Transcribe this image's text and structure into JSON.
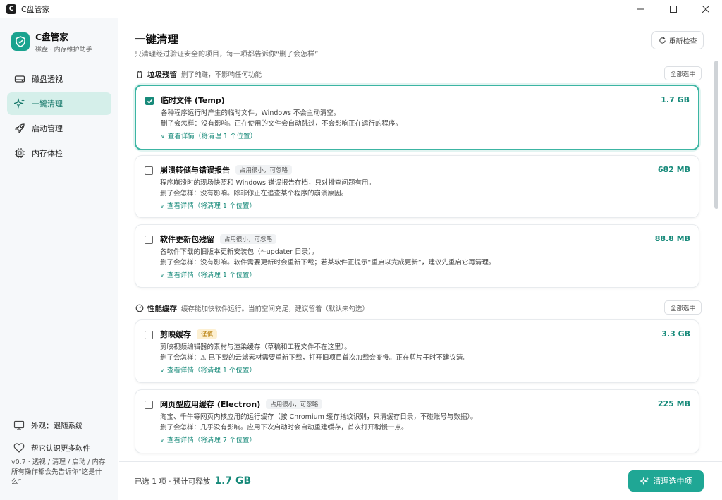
{
  "window": {
    "title": "C盘管家",
    "app_icon": "C",
    "controls": [
      "minimize-icon",
      "maximize-icon",
      "close-icon"
    ]
  },
  "brand": {
    "name": "C盘管家",
    "subtitle": "磁盘 · 内存维护助手"
  },
  "nav": [
    {
      "label": "磁盘透视",
      "icon": "disk-icon",
      "active": false
    },
    {
      "label": "一键清理",
      "icon": "sparkle-icon",
      "active": true
    },
    {
      "label": "启动管理",
      "icon": "rocket-icon",
      "active": false
    },
    {
      "label": "内存体检",
      "icon": "chip-icon",
      "active": false
    }
  ],
  "sidebar_bottom": {
    "appearance": "外观：跟随系统",
    "support": "帮它认识更多软件",
    "version_line1": "v0.7 · 透视 / 清理 / 启动 / 内存",
    "version_line2": "所有操作都会先告诉你“这是什么”"
  },
  "header": {
    "title": "一键清理",
    "subtitle": "只清理经过验证安全的项目，每一项都告诉你“删了会怎样”",
    "rescan_label": "重新检查"
  },
  "sections": [
    {
      "title": "垃圾残留",
      "desc": "删了纯赚，不影响任何功能",
      "select_all": "全部选中",
      "icon": "trash-icon",
      "items": [
        {
          "title": "临时文件 (Temp)",
          "tag": "",
          "desc": "各种程序运行时产生的临时文件，Windows 不会主动清空。",
          "impact": "删了会怎样：没有影响。正在使用的文件会自动跳过，不会影响正在运行的程序。",
          "detail": "查看详情（将清理 1 个位置）",
          "size": "1.7 GB",
          "checked": true
        },
        {
          "title": "崩溃转储与错误报告",
          "tag": "占用很小，可忽略",
          "desc": "程序崩溃时的现场快照和 Windows 错误报告存档，只对排查问题有用。",
          "impact": "删了会怎样：没有影响。除非你正在追查某个程序的崩溃原因。",
          "detail": "查看详情（将清理 1 个位置）",
          "size": "682 MB",
          "checked": false
        },
        {
          "title": "软件更新包残留",
          "tag": "占用很小，可忽略",
          "desc": "各软件下载的旧版本更新安装包（*-updater 目录）。",
          "impact": "删了会怎样：没有影响。软件需要更新时会重新下载；若某软件正提示“重启以完成更新”，建议先重启它再清理。",
          "detail": "查看详情（将清理 1 个位置）",
          "size": "88.8 MB",
          "checked": false
        }
      ]
    },
    {
      "title": "性能缓存",
      "desc": "缓存能加快软件运行。当前空间充足，建议留着（默认未勾选）",
      "select_all": "全部选中",
      "icon": "gauge-icon",
      "items": [
        {
          "title": "剪映缓存",
          "tag": "谨慎",
          "desc": "剪映视频编辑器的素材与渲染缓存（草稿和工程文件不在这里）。",
          "impact": "删了会怎样：⚠ 已下载的云端素材需要重新下载，打开旧项目首次加载会变慢。正在剪片子时不建议清。",
          "detail": "查看详情（将清理 1 个位置）",
          "size": "3.3 GB",
          "checked": false
        },
        {
          "title": "网页型应用缓存 (Electron)",
          "tag": "占用很小，可忽略",
          "desc": "淘宝、千牛等网页内核应用的运行缓存（按 Chromium 缓存指纹识别，只清缓存目录，不碰账号与数据）。",
          "impact": "删了会怎样：几乎没有影响。应用下次启动时会自动重建缓存，首次打开稍慢一点。",
          "detail": "查看详情（将清理 7 个位置）",
          "size": "225 MB",
          "checked": false
        }
      ]
    }
  ],
  "footer": {
    "summary": "已选 1 项 · 预计可释放",
    "size": "1.7 GB",
    "clean_label": "清理选中项"
  },
  "colors": {
    "accent": "#1fa795",
    "accent_dark": "#178a7a",
    "active_nav_bg": "#d5efea",
    "warn_tag": "#fdf0d2"
  }
}
